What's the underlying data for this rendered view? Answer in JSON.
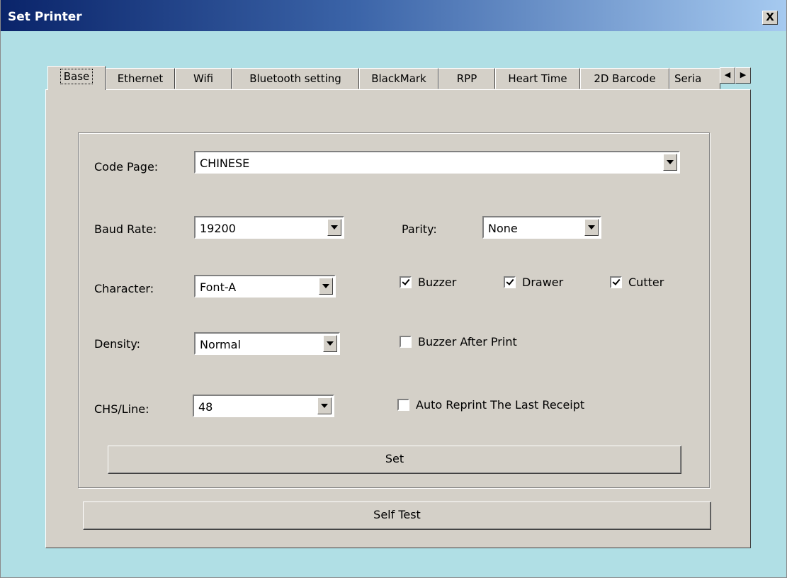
{
  "window": {
    "title": "Set Printer",
    "close_label": "X"
  },
  "tabs": [
    {
      "label": "Base"
    },
    {
      "label": "Ethernet"
    },
    {
      "label": "Wifi"
    },
    {
      "label": "Bluetooth setting"
    },
    {
      "label": "BlackMark"
    },
    {
      "label": "RPP"
    },
    {
      "label": "Heart Time"
    },
    {
      "label": "2D Barcode"
    },
    {
      "label": "Seria"
    }
  ],
  "active_tab": "Base",
  "tab_scroll": {
    "left": "◀",
    "right": "▶"
  },
  "form": {
    "code_page": {
      "label": "Code Page:",
      "value": "CHINESE"
    },
    "baud_rate": {
      "label": "Baud Rate:",
      "value": "19200"
    },
    "parity": {
      "label": "Parity:",
      "value": "None"
    },
    "character": {
      "label": "Character:",
      "value": "Font-A"
    },
    "density": {
      "label": "Density:",
      "value": "Normal"
    },
    "chs_line": {
      "label": "CHS/Line:",
      "value": "48"
    },
    "buzzer": {
      "label": "Buzzer",
      "checked": true
    },
    "drawer": {
      "label": "Drawer",
      "checked": true
    },
    "cutter": {
      "label": "Cutter",
      "checked": true
    },
    "buzzer_after_print": {
      "label": "Buzzer After Print",
      "checked": false
    },
    "auto_reprint": {
      "label": "Auto Reprint The Last Receipt",
      "checked": false
    },
    "set_button": "Set"
  },
  "self_test_button": "Self Test",
  "colors": {
    "background": "#b0dfe5",
    "panel": "#d4d0c8",
    "titlebar_start": "#0a246a",
    "titlebar_end": "#a6caf0"
  }
}
